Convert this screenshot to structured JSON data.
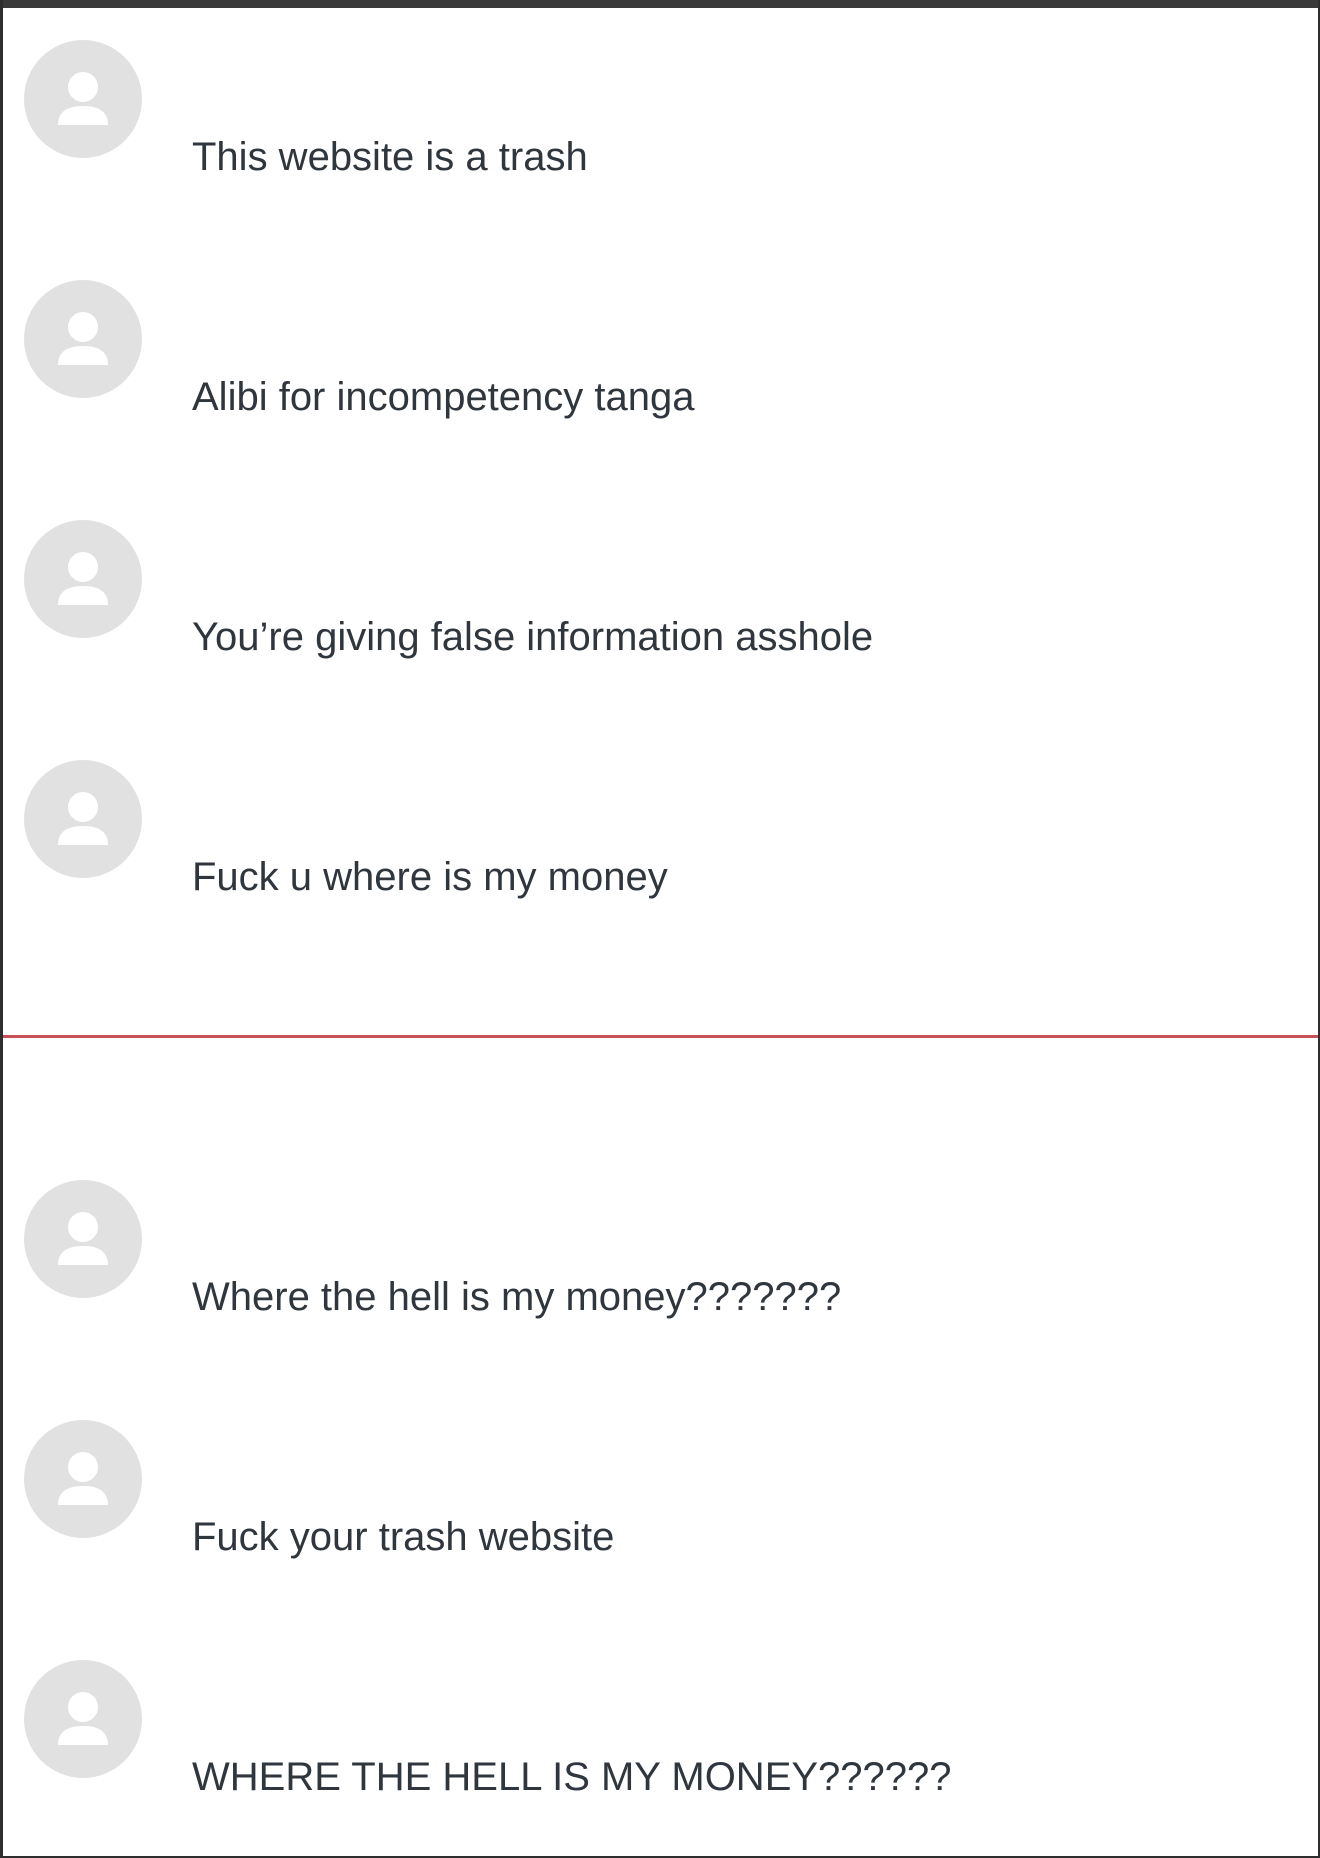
{
  "threads": [
    {
      "comments": [
        {
          "avatar_icon": "default-user-icon",
          "text": "This website is a trash"
        },
        {
          "avatar_icon": "default-user-icon",
          "text": "Alibi for incompetency tanga"
        },
        {
          "avatar_icon": "default-user-icon",
          "text": "You’re giving false information asshole"
        },
        {
          "avatar_icon": "default-user-icon",
          "text": "Fuck u where is my money"
        }
      ]
    },
    {
      "comments": [
        {
          "avatar_icon": "default-user-icon",
          "text": "Where the hell is my money???????"
        },
        {
          "avatar_icon": "default-user-icon",
          "text": "Fuck your trash website"
        },
        {
          "avatar_icon": "default-user-icon",
          "text": "WHERE THE HELL IS MY MONEY??????"
        }
      ]
    }
  ],
  "colors": {
    "divider": "#c94f55",
    "avatar_bg": "#e1e1e1",
    "text": "#2f363d"
  }
}
